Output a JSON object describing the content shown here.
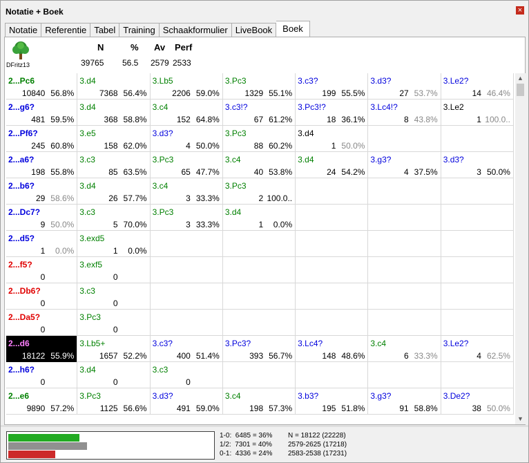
{
  "window": {
    "title": "Notatie + Boek",
    "close_glyph": "×"
  },
  "tabs": [
    {
      "label": "Notatie",
      "active": false
    },
    {
      "label": "Referentie",
      "active": false
    },
    {
      "label": "Tabel",
      "active": false
    },
    {
      "label": "Training",
      "active": false
    },
    {
      "label": "Schaakformulier",
      "active": false
    },
    {
      "label": "LiveBook",
      "active": false
    },
    {
      "label": "Boek",
      "active": true
    }
  ],
  "engine": {
    "name": "DFritz13",
    "icon": "tree-icon"
  },
  "header": {
    "labels": {
      "n": "N",
      "pct": "%",
      "av": "Av",
      "perf": "Perf"
    },
    "values": {
      "n": "39765",
      "pct": "56.5",
      "av": "2579",
      "perf": "2533"
    }
  },
  "colors": {
    "green": "#008000",
    "blue": "#0000dd",
    "red": "#e00000",
    "pink": "#ff80ff",
    "bar_white": "#22aa22",
    "bar_draw": "#909090",
    "bar_black": "#cc2a2a"
  },
  "rows": [
    {
      "move": "2...Pc6",
      "color": "green",
      "count": "10840",
      "pct": "56.8%",
      "selected": false,
      "cont": [
        {
          "move": "3.d4",
          "color": "green",
          "count": "7368",
          "pct": "56.4%",
          "dim": false
        },
        {
          "move": "3.Lb5",
          "color": "green",
          "count": "2206",
          "pct": "59.0%",
          "dim": false
        },
        {
          "move": "3.Pc3",
          "color": "green",
          "count": "1329",
          "pct": "55.1%",
          "dim": false
        },
        {
          "move": "3.c3?",
          "color": "blue",
          "count": "199",
          "pct": "55.5%",
          "dim": false
        },
        {
          "move": "3.d3?",
          "color": "blue",
          "count": "27",
          "pct": "53.7%",
          "dim": true
        },
        {
          "move": "3.Le2?",
          "color": "blue",
          "count": "14",
          "pct": "46.4%",
          "dim": true
        }
      ]
    },
    {
      "move": "2...g6?",
      "color": "blue",
      "count": "481",
      "pct": "59.5%",
      "selected": false,
      "cont": [
        {
          "move": "3.d4",
          "color": "green",
          "count": "368",
          "pct": "58.8%",
          "dim": false
        },
        {
          "move": "3.c4",
          "color": "green",
          "count": "152",
          "pct": "64.8%",
          "dim": false
        },
        {
          "move": "3.c3!?",
          "color": "blue",
          "count": "67",
          "pct": "61.2%",
          "dim": false
        },
        {
          "move": "3.Pc3!?",
          "color": "blue",
          "count": "18",
          "pct": "36.1%",
          "dim": false
        },
        {
          "move": "3.Lc4!?",
          "color": "blue",
          "count": "8",
          "pct": "43.8%",
          "dim": true
        },
        {
          "move": "3.Le2",
          "color": "black",
          "count": "1",
          "pct": "100.0..",
          "dim": true
        }
      ]
    },
    {
      "move": "2...Pf6?",
      "color": "blue",
      "count": "245",
      "pct": "60.8%",
      "selected": false,
      "cont": [
        {
          "move": "3.e5",
          "color": "green",
          "count": "158",
          "pct": "62.0%",
          "dim": false
        },
        {
          "move": "3.d3?",
          "color": "blue",
          "count": "4",
          "pct": "50.0%",
          "dim": false
        },
        {
          "move": "3.Pc3",
          "color": "green",
          "count": "88",
          "pct": "60.2%",
          "dim": false
        },
        {
          "move": "3.d4",
          "color": "black",
          "count": "1",
          "pct": "50.0%",
          "dim": true
        },
        {
          "move": "",
          "color": "black",
          "count": "",
          "pct": "",
          "dim": false
        },
        {
          "move": "",
          "color": "black",
          "count": "",
          "pct": "",
          "dim": false
        }
      ]
    },
    {
      "move": "2...a6?",
      "color": "blue",
      "count": "198",
      "pct": "55.8%",
      "selected": false,
      "cont": [
        {
          "move": "3.c3",
          "color": "green",
          "count": "85",
          "pct": "63.5%",
          "dim": false
        },
        {
          "move": "3.Pc3",
          "color": "green",
          "count": "65",
          "pct": "47.7%",
          "dim": false
        },
        {
          "move": "3.c4",
          "color": "green",
          "count": "40",
          "pct": "53.8%",
          "dim": false
        },
        {
          "move": "3.d4",
          "color": "green",
          "count": "24",
          "pct": "54.2%",
          "dim": false
        },
        {
          "move": "3.g3?",
          "color": "blue",
          "count": "4",
          "pct": "37.5%",
          "dim": false
        },
        {
          "move": "3.d3?",
          "color": "blue",
          "count": "3",
          "pct": "50.0%",
          "dim": false
        }
      ]
    },
    {
      "move": "2...b6?",
      "color": "blue",
      "count": "29",
      "pct": "58.6%",
      "selected": false,
      "pct_dim": true,
      "cont": [
        {
          "move": "3.d4",
          "color": "green",
          "count": "26",
          "pct": "57.7%",
          "dim": false
        },
        {
          "move": "3.c4",
          "color": "green",
          "count": "3",
          "pct": "33.3%",
          "dim": false
        },
        {
          "move": "3.Pc3",
          "color": "green",
          "count": "2",
          "pct": "100.0..",
          "dim": false
        },
        {
          "move": "",
          "color": "black",
          "count": "",
          "pct": "",
          "dim": false
        },
        {
          "move": "",
          "color": "black",
          "count": "",
          "pct": "",
          "dim": false
        },
        {
          "move": "",
          "color": "black",
          "count": "",
          "pct": "",
          "dim": false
        }
      ]
    },
    {
      "move": "2...Dc7?",
      "color": "blue",
      "count": "9",
      "pct": "50.0%",
      "selected": false,
      "pct_dim": true,
      "cont": [
        {
          "move": "3.c3",
          "color": "green",
          "count": "5",
          "pct": "70.0%",
          "dim": false
        },
        {
          "move": "3.Pc3",
          "color": "green",
          "count": "3",
          "pct": "33.3%",
          "dim": false
        },
        {
          "move": "3.d4",
          "color": "green",
          "count": "1",
          "pct": "0.0%",
          "dim": false
        },
        {
          "move": "",
          "color": "black",
          "count": "",
          "pct": "",
          "dim": false
        },
        {
          "move": "",
          "color": "black",
          "count": "",
          "pct": "",
          "dim": false
        },
        {
          "move": "",
          "color": "black",
          "count": "",
          "pct": "",
          "dim": false
        }
      ]
    },
    {
      "move": "2...d5?",
      "color": "blue",
      "count": "1",
      "pct": "0.0%",
      "selected": false,
      "pct_dim": true,
      "cont": [
        {
          "move": "3.exd5",
          "color": "green",
          "count": "1",
          "pct": "0.0%",
          "dim": false
        },
        {
          "move": "",
          "color": "black",
          "count": "",
          "pct": "",
          "dim": false
        },
        {
          "move": "",
          "color": "black",
          "count": "",
          "pct": "",
          "dim": false
        },
        {
          "move": "",
          "color": "black",
          "count": "",
          "pct": "",
          "dim": false
        },
        {
          "move": "",
          "color": "black",
          "count": "",
          "pct": "",
          "dim": false
        },
        {
          "move": "",
          "color": "black",
          "count": "",
          "pct": "",
          "dim": false
        }
      ]
    },
    {
      "move": "2...f5?",
      "color": "red",
      "count": "0",
      "pct": "",
      "selected": false,
      "cont": [
        {
          "move": "3.exf5",
          "color": "green",
          "count": "0",
          "pct": "",
          "dim": false
        },
        {
          "move": "",
          "color": "black",
          "count": "",
          "pct": "",
          "dim": false
        },
        {
          "move": "",
          "color": "black",
          "count": "",
          "pct": "",
          "dim": false
        },
        {
          "move": "",
          "color": "black",
          "count": "",
          "pct": "",
          "dim": false
        },
        {
          "move": "",
          "color": "black",
          "count": "",
          "pct": "",
          "dim": false
        },
        {
          "move": "",
          "color": "black",
          "count": "",
          "pct": "",
          "dim": false
        }
      ]
    },
    {
      "move": "2...Db6?",
      "color": "red",
      "count": "0",
      "pct": "",
      "selected": false,
      "cont": [
        {
          "move": "3.c3",
          "color": "green",
          "count": "0",
          "pct": "",
          "dim": false
        },
        {
          "move": "",
          "color": "black",
          "count": "",
          "pct": "",
          "dim": false
        },
        {
          "move": "",
          "color": "black",
          "count": "",
          "pct": "",
          "dim": false
        },
        {
          "move": "",
          "color": "black",
          "count": "",
          "pct": "",
          "dim": false
        },
        {
          "move": "",
          "color": "black",
          "count": "",
          "pct": "",
          "dim": false
        },
        {
          "move": "",
          "color": "black",
          "count": "",
          "pct": "",
          "dim": false
        }
      ]
    },
    {
      "move": "2...Da5?",
      "color": "red",
      "count": "0",
      "pct": "",
      "selected": false,
      "cont": [
        {
          "move": "3.Pc3",
          "color": "green",
          "count": "0",
          "pct": "",
          "dim": false
        },
        {
          "move": "",
          "color": "black",
          "count": "",
          "pct": "",
          "dim": false
        },
        {
          "move": "",
          "color": "black",
          "count": "",
          "pct": "",
          "dim": false
        },
        {
          "move": "",
          "color": "black",
          "count": "",
          "pct": "",
          "dim": false
        },
        {
          "move": "",
          "color": "black",
          "count": "",
          "pct": "",
          "dim": false
        },
        {
          "move": "",
          "color": "black",
          "count": "",
          "pct": "",
          "dim": false
        }
      ]
    },
    {
      "move": "2...d6",
      "color": "pink",
      "count": "18122",
      "pct": "55.9%",
      "selected": true,
      "cont": [
        {
          "move": "3.Lb5+",
          "color": "green",
          "count": "1657",
          "pct": "52.2%",
          "dim": false
        },
        {
          "move": "3.c3?",
          "color": "blue",
          "count": "400",
          "pct": "51.4%",
          "dim": false
        },
        {
          "move": "3.Pc3?",
          "color": "blue",
          "count": "393",
          "pct": "56.7%",
          "dim": false
        },
        {
          "move": "3.Lc4?",
          "color": "blue",
          "count": "148",
          "pct": "48.6%",
          "dim": false
        },
        {
          "move": "3.c4",
          "color": "green",
          "count": "6",
          "pct": "33.3%",
          "dim": true
        },
        {
          "move": "3.Le2?",
          "color": "blue",
          "count": "4",
          "pct": "62.5%",
          "dim": true
        }
      ]
    },
    {
      "move": "2...h6?",
      "color": "blue",
      "count": "0",
      "pct": "",
      "selected": false,
      "cont": [
        {
          "move": "3.d4",
          "color": "green",
          "count": "0",
          "pct": "",
          "dim": false
        },
        {
          "move": "3.c3",
          "color": "green",
          "count": "0",
          "pct": "",
          "dim": false
        },
        {
          "move": "",
          "color": "black",
          "count": "",
          "pct": "",
          "dim": false
        },
        {
          "move": "",
          "color": "black",
          "count": "",
          "pct": "",
          "dim": false
        },
        {
          "move": "",
          "color": "black",
          "count": "",
          "pct": "",
          "dim": false
        },
        {
          "move": "",
          "color": "black",
          "count": "",
          "pct": "",
          "dim": false
        }
      ]
    },
    {
      "move": "2...e6",
      "color": "green",
      "count": "9890",
      "pct": "57.2%",
      "selected": false,
      "cont": [
        {
          "move": "3.Pc3",
          "color": "green",
          "count": "1125",
          "pct": "56.6%",
          "dim": false
        },
        {
          "move": "3.d3?",
          "color": "blue",
          "count": "491",
          "pct": "59.0%",
          "dim": false
        },
        {
          "move": "3.c4",
          "color": "green",
          "count": "198",
          "pct": "57.3%",
          "dim": false
        },
        {
          "move": "3.b3?",
          "color": "blue",
          "count": "195",
          "pct": "51.8%",
          "dim": false
        },
        {
          "move": "3.g3?",
          "color": "blue",
          "count": "91",
          "pct": "58.8%",
          "dim": false
        },
        {
          "move": "3.De2?",
          "color": "blue",
          "count": "38",
          "pct": "50.0%",
          "dim": true
        }
      ]
    }
  ],
  "scroll": {
    "up_glyph": "▲",
    "down_glyph": "▼"
  },
  "results": {
    "white_fraction": 0.36,
    "draw_fraction": 0.4,
    "black_fraction": 0.24,
    "line1": "1-0:  6485 = 36%",
    "line2": "1/2:  7301 = 40%",
    "line3": "0-1:  4336 = 24%",
    "col2_line1": "N = 18122 (22228)",
    "col2_line2": "2579-2625 (17218)",
    "col2_line3": "2583-2538 (17231)"
  }
}
